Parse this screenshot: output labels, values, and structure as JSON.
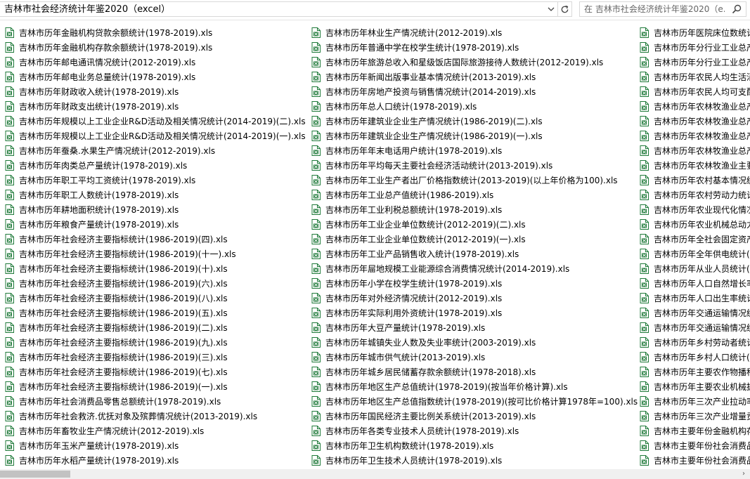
{
  "address": {
    "path": "吉林市社会经济统计年鉴2020（excel）",
    "dropdown_icon": "chevron-down-icon",
    "refresh_icon": "refresh-icon"
  },
  "search": {
    "placeholder": "在 吉林市社会经济统计年鉴2020（e...",
    "icon": "search-icon"
  },
  "columns": [
    [
      "吉林市历年金融机构贷款余额统计(1978-2019).xls",
      "吉林市历年金融机构存款余额统计(1978-2019).xls",
      "吉林市历年邮电通讯情况统计(2012-2019).xls",
      "吉林市历年邮电业务总量统计(1978-2019).xls",
      "吉林市历年财政收入统计(1978-2019).xls",
      "吉林市历年财政支出统计(1978-2019).xls",
      "吉林市历年规模以上工业企业R&D活动及相关情况统计(2014-2019)(二).xls",
      "吉林市历年规模以上工业企业R&D活动及相关情况统计(2014-2019)(一).xls",
      "吉林市历年蚕桑.水果生产情况统计(2012-2019).xls",
      "吉林市历年肉类总产量统计(1978-2019).xls",
      "吉林市历年职工平均工资统计(1978-2019).xls",
      "吉林市历年职工人数统计(1978-2019).xls",
      "吉林市历年耕地面积统计(1978-2019).xls",
      "吉林市历年粮食产量统计(1978-2019).xls",
      "吉林市历年社会经济主要指标统计(1986-2019)(四).xls",
      "吉林市历年社会经济主要指标统计(1986-2019)(十一).xls",
      "吉林市历年社会经济主要指标统计(1986-2019)(十).xls",
      "吉林市历年社会经济主要指标统计(1986-2019)(六).xls",
      "吉林市历年社会经济主要指标统计(1986-2019)(八).xls",
      "吉林市历年社会经济主要指标统计(1986-2019)(五).xls",
      "吉林市历年社会经济主要指标统计(1986-2019)(二).xls",
      "吉林市历年社会经济主要指标统计(1986-2019)(九).xls",
      "吉林市历年社会经济主要指标统计(1986-2019)(三).xls",
      "吉林市历年社会经济主要指标统计(1986-2019)(七).xls",
      "吉林市历年社会经济主要指标统计(1986-2019)(一).xls",
      "吉林市历年社会消费品零售总额统计(1978-2019).xls",
      "吉林市历年社会救济.优抚对象及殡葬情况统计(2013-2019).xls",
      "吉林市历年畜牧业生产情况统计(2012-2019).xls",
      "吉林市历年玉米产量统计(1978-2019).xls",
      "吉林市历年水稻产量统计(1978-2019).xls"
    ],
    [
      "吉林市历年林业生产情况统计(2012-2019).xls",
      "吉林市历年普通中学在校学生统计(1978-2019).xls",
      "吉林市历年旅游总收入和星级饭店国际旅游接待人数统计(2012-2019).xls",
      "吉林市历年新闻出版事业基本情况统计(2013-2019).xls",
      "吉林市历年房地产投资与销售情况统计(2014-2019).xls",
      "吉林市历年总人口统计(1978-2019).xls",
      "吉林市历年建筑业企业生产情况统计(1986-2019)(二).xls",
      "吉林市历年建筑业企业生产情况统计(1986-2019)(一).xls",
      "吉林市历年年末电话用户统计(1978-2019).xls",
      "吉林市历年平均每天主要社会经济活动统计(2013-2019).xls",
      "吉林市历年工业生产者出厂价格指数统计(2013-2019)(以上年价格为100).xls",
      "吉林市历年工业总产值统计(1986-2019).xls",
      "吉林市历年工业利税总额统计(1978-2019).xls",
      "吉林市历年工业企业单位数统计(2012-2019)(二).xls",
      "吉林市历年工业企业单位数统计(2012-2019)(一).xls",
      "吉林市历年工业产品销售收入统计(1978-2019).xls",
      "吉林市历年屇地规模工业能源综合消费情况统计(2014-2019).xls",
      "吉林市历年小学在校学生统计(1978-2019).xls",
      "吉林市历年对外经济情况统计(2012-2019).xls",
      "吉林市历年实际利用外资统计(1978-2019).xls",
      "吉林市历年大豆产量统计(1978-2019).xls",
      "吉林市历年城镇失业人数及失业率统计(2003-2019).xls",
      "吉林市历年城市供气统计(2013-2019).xls",
      "吉林市历年城乡居民储蓄存款余额统计(1978-2018).xls",
      "吉林市历年地区生产总值统计(1978-2019)(按当年价格计算).xls",
      "吉林市历年地区生产总值指数统计(1978-2019)(按可比价格计算1978年=100).xls",
      "吉林市历年国民经济主要比例关系统计(2013-2019).xls",
      "吉林市历年各类专业技术人员统计(1978-2019).xls",
      "吉林市历年卫生机构数统计(1978-2019).xls",
      "吉林市历年卫生技术人员统计(1978-2019).xls"
    ],
    [
      "吉林市历年医院床位数统计",
      "吉林市历年分行业工业总产",
      "吉林市历年分行业工业总产",
      "吉林市历年农民人均生活消",
      "吉林市历年农民人均可支配",
      "吉林市历年农林牧渔业总产",
      "吉林市历年农林牧渔业总产",
      "吉林市历年农林牧渔业总产",
      "吉林市历年农林牧渔业总产",
      "吉林市历年农林牧渔业主要",
      "吉林市历年农村基本情况统",
      "吉林市历年农村劳动力统计",
      "吉林市历年农业现代化情况",
      "吉林市历年农业机械总动力",
      "吉林市历年全社会固定资产",
      "吉林市历年全年供电统计(2",
      "吉林市历年从业人员统计(1",
      "吉林市历年人口自然增长率",
      "吉林市历年人口出生率统计",
      "吉林市历年交通运输情况统",
      "吉林市历年交通运输情况统",
      "吉林市历年乡村劳动者统计",
      "吉林市历年乡村人口统计(1",
      "吉林市历年主要农作物播种",
      "吉林市历年主要农业机械拥",
      "吉林市历年三次产业拉动率",
      "吉林市历年三次产业增量贡",
      "吉林市主要年份金融机构存",
      "吉林市主要年份社会消费品",
      "吉林市主要年份社会消费品"
    ]
  ],
  "colors": {
    "file_icon_green": "#1f7a3a",
    "scroll_thumb": "#c2c2c2"
  }
}
